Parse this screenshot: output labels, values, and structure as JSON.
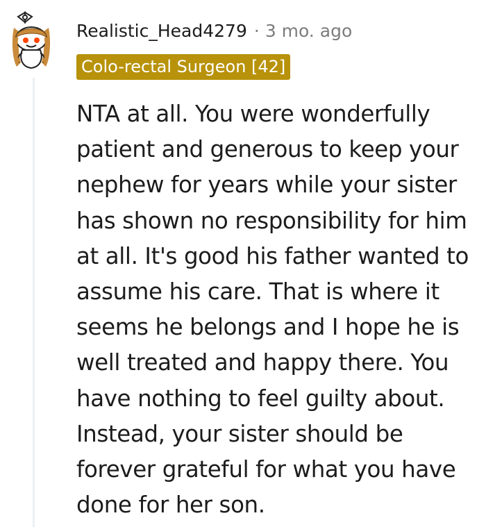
{
  "comment": {
    "author": "Realistic_Head4279",
    "separator": "·",
    "timestamp": "3 mo. ago",
    "flair": "Colo-rectal Surgeon [42]",
    "flair_color": "#b8920a",
    "body": "NTA at all. You were wonderfully patient and generous to keep your nephew for years while your sister has shown no responsibility for him at all. It's good his father wanted to assume his care. That is where it seems he belongs and I hope he is well treated and happy there. You have nothing to feel guilty about. Instead, your sister should be forever grateful for what you have done for her son.",
    "avatar_icon": "snoo-avatar-icon"
  }
}
